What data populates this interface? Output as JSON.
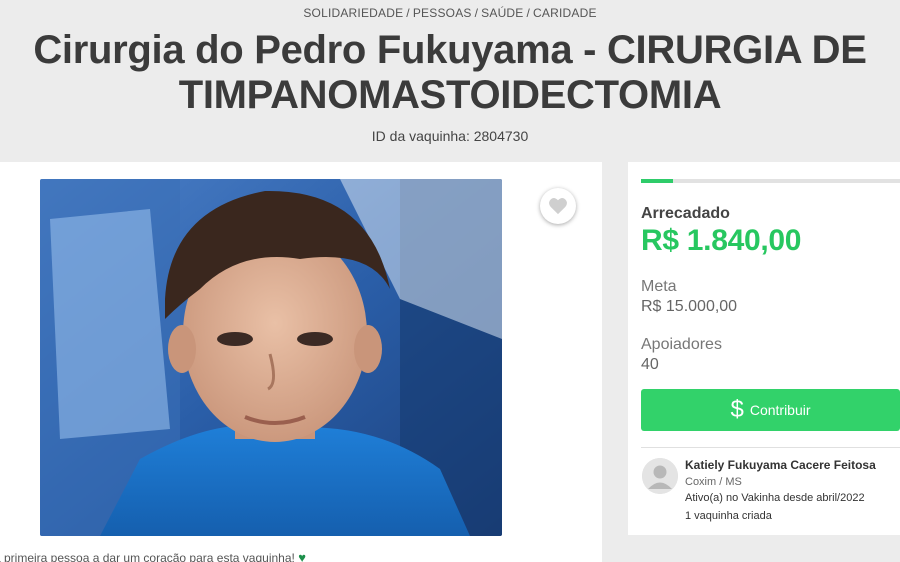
{
  "header": {
    "categories": [
      "SOLIDARIEDADE",
      "PESSOAS",
      "SAÚDE",
      "CARIDADE"
    ],
    "title": "Cirurgia do Pedro Fukuyama - CIRURGIA DE TIMPANOMASTOIDECTOMIA",
    "vaquinha_id": "ID da vaquinha: 2804730"
  },
  "left": {
    "photo_icon": "boy-photo",
    "heart_icon": "heart-icon",
    "first_heart_text": "a primeira pessoa a dar um coração para esta vaquinha!"
  },
  "right": {
    "progress_fraction": 0.1227,
    "raised_label": "Arrecadado",
    "raised_value": "R$ 1.840,00",
    "goal_label": "Meta",
    "goal_value": "R$ 15.000,00",
    "supporters_label": "Apoiadores",
    "supporters_value": "40",
    "contribute_label": "Contribuir",
    "contribute_icon": "$",
    "organizer": {
      "name": "Katiely Fukuyama Cacere Feitosa",
      "location": "Coxim / MS",
      "since": "Ativo(a) no Vakinha desde abril/2022",
      "count": "1 vaquinha criada"
    }
  },
  "colors": {
    "accent_green": "#32d26a",
    "raised_green": "#27c760",
    "heart_green": "#1c8f4a"
  }
}
